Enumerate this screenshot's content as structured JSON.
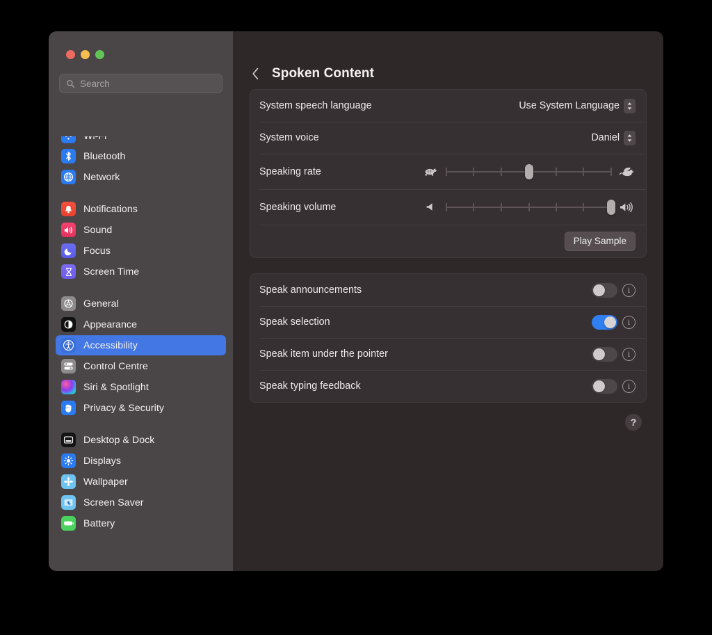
{
  "window": {
    "traffic_lights": [
      "close",
      "minimize",
      "zoom"
    ],
    "colors": {
      "accent": "#4277e4",
      "toggle_on": "#2f7ff0",
      "sidebar_bg": "#4a4547",
      "content_bg": "#2f2829",
      "card_bg": "#373032"
    }
  },
  "search": {
    "placeholder": "Search",
    "value": ""
  },
  "sidebar": {
    "groups": [
      {
        "items": [
          {
            "label": "Wi-Fi",
            "icon": "wifi-icon",
            "clipped": true
          },
          {
            "label": "Bluetooth",
            "icon": "bluetooth-icon"
          },
          {
            "label": "Network",
            "icon": "network-icon"
          }
        ]
      },
      {
        "items": [
          {
            "label": "Notifications",
            "icon": "notifications-icon"
          },
          {
            "label": "Sound",
            "icon": "sound-icon"
          },
          {
            "label": "Focus",
            "icon": "focus-icon"
          },
          {
            "label": "Screen Time",
            "icon": "screen-time-icon"
          }
        ]
      },
      {
        "items": [
          {
            "label": "General",
            "icon": "general-icon"
          },
          {
            "label": "Appearance",
            "icon": "appearance-icon"
          },
          {
            "label": "Accessibility",
            "icon": "accessibility-icon",
            "selected": true
          },
          {
            "label": "Control Centre",
            "icon": "control-centre-icon"
          },
          {
            "label": "Siri & Spotlight",
            "icon": "siri-icon"
          },
          {
            "label": "Privacy & Security",
            "icon": "privacy-icon"
          }
        ]
      },
      {
        "items": [
          {
            "label": "Desktop & Dock",
            "icon": "desktop-dock-icon"
          },
          {
            "label": "Displays",
            "icon": "displays-icon"
          },
          {
            "label": "Wallpaper",
            "icon": "wallpaper-icon"
          },
          {
            "label": "Screen Saver",
            "icon": "screen-saver-icon"
          },
          {
            "label": "Battery",
            "icon": "battery-icon"
          }
        ]
      }
    ]
  },
  "header": {
    "back": "back-chevron",
    "title": "Spoken Content"
  },
  "speech_card": {
    "language_label": "System speech language",
    "language_value": "Use System Language",
    "voice_label": "System voice",
    "voice_value": "Daniel",
    "rate_label": "Speaking rate",
    "rate_value": 50,
    "rate_min_icon": "tortoise-icon",
    "rate_max_icon": "hare-icon",
    "volume_label": "Speaking volume",
    "volume_value": 100,
    "volume_min_icon": "speaker-low-icon",
    "volume_max_icon": "speaker-high-icon",
    "slider_ticks": 7,
    "play_sample": "Play Sample"
  },
  "options_card": {
    "rows": [
      {
        "label": "Speak announcements",
        "on": false
      },
      {
        "label": "Speak selection",
        "on": true
      },
      {
        "label": "Speak item under the pointer",
        "on": false
      },
      {
        "label": "Speak typing feedback",
        "on": false
      }
    ],
    "info_glyph": "i"
  },
  "help": {
    "glyph": "?"
  }
}
